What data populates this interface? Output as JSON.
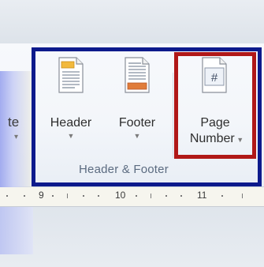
{
  "ribbon": {
    "partial_label": "te",
    "group_label": "Header & Footer",
    "buttons": [
      {
        "label": "Header",
        "icon": "header-icon"
      },
      {
        "label": "Footer",
        "icon": "footer-icon"
      },
      {
        "label_line1": "Page",
        "label_line2": "Number",
        "icon": "page-number-icon"
      }
    ]
  },
  "ruler": {
    "numbers": [
      "9",
      "10",
      "11"
    ]
  },
  "colors": {
    "highlight_group": "#0d1a8c",
    "highlight_button": "#b01818",
    "icon_header_band": "#f2b93c",
    "icon_footer_band": "#e07c3a"
  }
}
